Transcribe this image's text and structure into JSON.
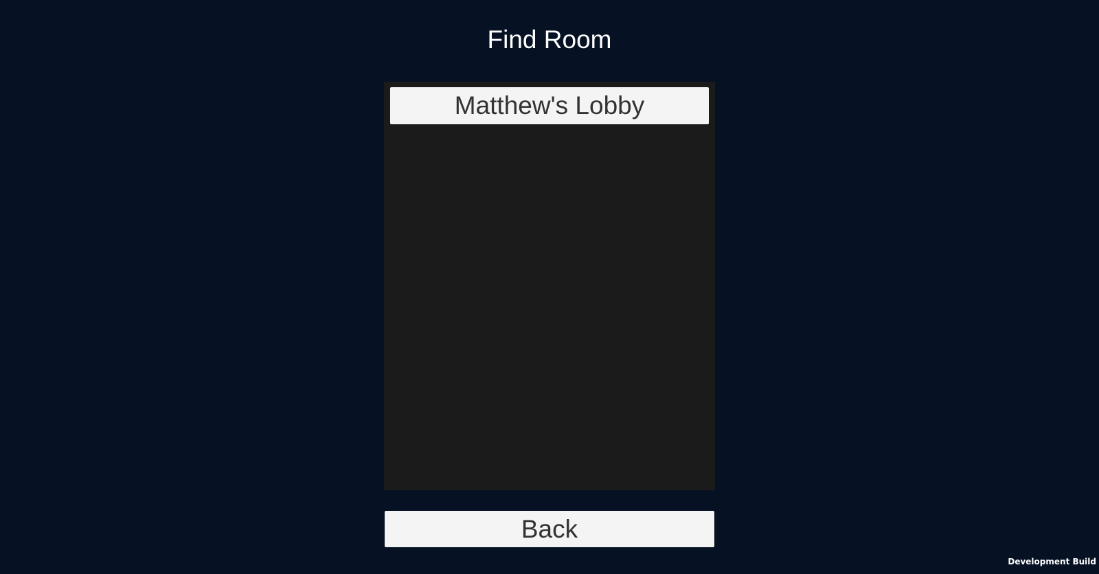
{
  "screen": {
    "title": "Find Room",
    "background_color": "#061124"
  },
  "room_list": {
    "background_color": "#1c1b1c",
    "rooms": [
      {
        "name": "Matthew's Lobby"
      }
    ]
  },
  "back_button": {
    "label": "Back"
  },
  "watermark": {
    "text": "Development Build"
  }
}
